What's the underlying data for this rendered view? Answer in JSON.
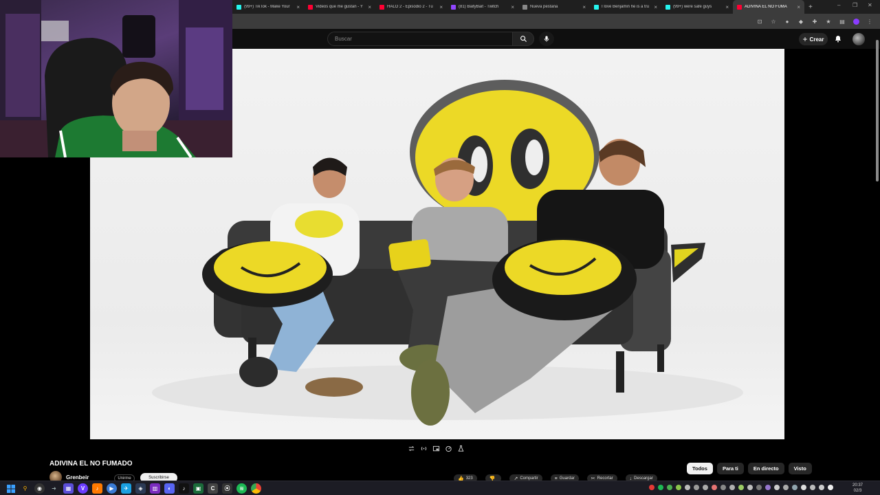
{
  "browser": {
    "tabs": [
      {
        "label": "(99+) TikTok - Make Your",
        "favicon_color": "#25f4ee"
      },
      {
        "label": "Videos que me gustan - Y",
        "favicon_color": "#ff0033"
      },
      {
        "label": "HALO 2 - Episodio 2 - Tu",
        "favicon_color": "#ff0033"
      },
      {
        "label": "(81) BaityBait - Twitch",
        "favicon_color": "#9146ff"
      },
      {
        "label": "Nueva pestaña",
        "favicon_color": "#888888"
      },
      {
        "label": "I love Benjamin he is a tru",
        "favicon_color": "#25f4ee"
      },
      {
        "label": "(99+) were safe guys",
        "favicon_color": "#25f4ee"
      },
      {
        "label": "ADIVINA EL NO FUMA",
        "favicon_color": "#ff0033",
        "active": true
      }
    ],
    "new_tab": "+",
    "window_controls": {
      "minimize": "–",
      "maximize": "❐",
      "close": "✕"
    }
  },
  "masthead": {
    "search_placeholder": "Buscar",
    "create_label": "Crear",
    "icons": [
      "search-icon",
      "mic-icon",
      "bell-icon",
      "avatar"
    ]
  },
  "player": {
    "controls": [
      "loop-icon",
      "broadcast-icon",
      "miniplayer-icon",
      "speed-icon",
      "lab-icon"
    ]
  },
  "video_info": {
    "title": "ADIVINA EL NO FUMADO",
    "channel": "Grenbeir",
    "join_label": "Unirme",
    "subscribe_label": "Suscribirse",
    "actions": [
      {
        "label": "323",
        "icon": "like-icon"
      },
      {
        "label": "",
        "icon": "dislike-icon"
      },
      {
        "label": "Compartir",
        "icon": "share-icon"
      },
      {
        "label": "Guardar",
        "icon": "save-icon"
      },
      {
        "label": "Recortar",
        "icon": "clip-icon"
      },
      {
        "label": "Descargar",
        "icon": "download-icon"
      }
    ]
  },
  "chips": [
    {
      "label": "Todos",
      "selected": true
    },
    {
      "label": "Para ti"
    },
    {
      "label": "En directo"
    },
    {
      "label": "Visto"
    }
  ],
  "taskbar": {
    "clock_time": "20:37",
    "clock_date": "02/3"
  }
}
